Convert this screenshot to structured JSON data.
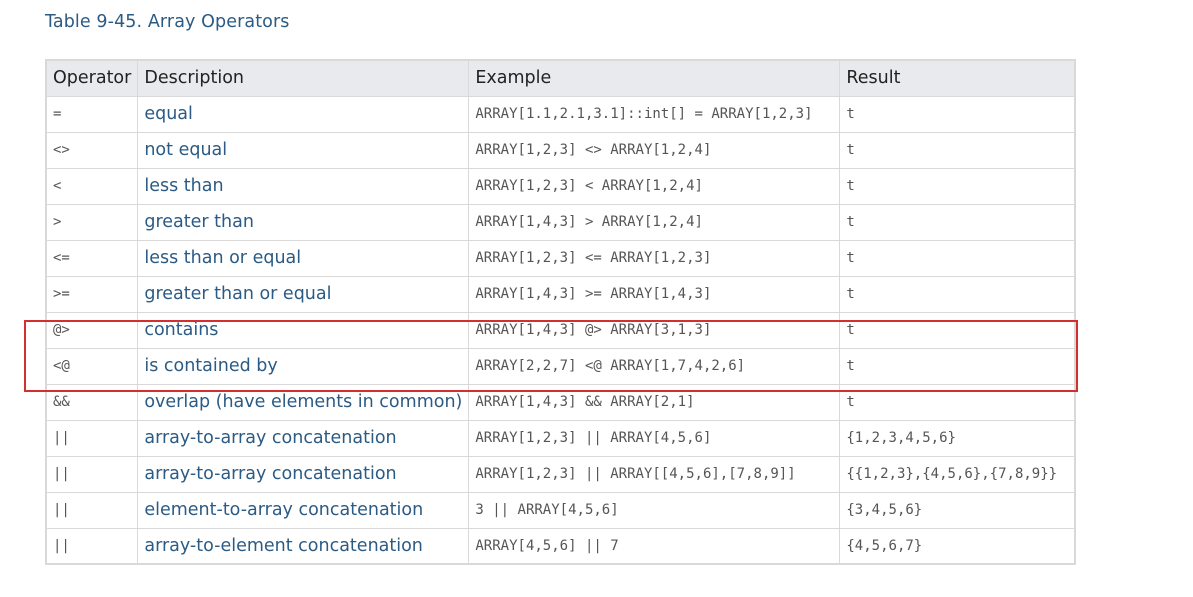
{
  "caption": "Table 9-45. Array Operators",
  "columns": {
    "operator": "Operator",
    "description": "Description",
    "example": "Example",
    "result": "Result"
  },
  "rows": [
    {
      "operator": "=",
      "description": "equal",
      "example": "ARRAY[1.1,2.1,3.1]::int[] = ARRAY[1,2,3]",
      "result": "t"
    },
    {
      "operator": "<>",
      "description": "not equal",
      "example": "ARRAY[1,2,3] <> ARRAY[1,2,4]",
      "result": "t"
    },
    {
      "operator": "<",
      "description": "less than",
      "example": "ARRAY[1,2,3] < ARRAY[1,2,4]",
      "result": "t"
    },
    {
      "operator": ">",
      "description": "greater than",
      "example": "ARRAY[1,4,3] > ARRAY[1,2,4]",
      "result": "t"
    },
    {
      "operator": "<=",
      "description": "less than or equal",
      "example": "ARRAY[1,2,3] <= ARRAY[1,2,3]",
      "result": "t"
    },
    {
      "operator": ">=",
      "description": "greater than or equal",
      "example": "ARRAY[1,4,3] >= ARRAY[1,4,3]",
      "result": "t"
    },
    {
      "operator": "@>",
      "description": "contains",
      "example": "ARRAY[1,4,3] @> ARRAY[3,1,3]",
      "result": "t"
    },
    {
      "operator": "<@",
      "description": "is contained by",
      "example": "ARRAY[2,2,7] <@ ARRAY[1,7,4,2,6]",
      "result": "t"
    },
    {
      "operator": "&&",
      "description": "overlap (have elements in common)",
      "example": "ARRAY[1,4,3] && ARRAY[2,1]",
      "result": "t"
    },
    {
      "operator": "||",
      "description": "array-to-array concatenation",
      "example": "ARRAY[1,2,3] || ARRAY[4,5,6]",
      "result": "{1,2,3,4,5,6}"
    },
    {
      "operator": "||",
      "description": "array-to-array concatenation",
      "example": "ARRAY[1,2,3] || ARRAY[[4,5,6],[7,8,9]]",
      "result": "{{1,2,3},{4,5,6},{7,8,9}}"
    },
    {
      "operator": "||",
      "description": "element-to-array concatenation",
      "example": "3 || ARRAY[4,5,6]",
      "result": "{3,4,5,6}"
    },
    {
      "operator": "||",
      "description": "array-to-element concatenation",
      "example": "ARRAY[4,5,6] || 7",
      "result": "{4,5,6,7}"
    }
  ],
  "colors": {
    "caption": "#2b5b84",
    "description_text": "#2b5b84",
    "header_bg": "#e8eaed",
    "border": "#d9d9d9",
    "highlight_box": "#d32f2f"
  }
}
